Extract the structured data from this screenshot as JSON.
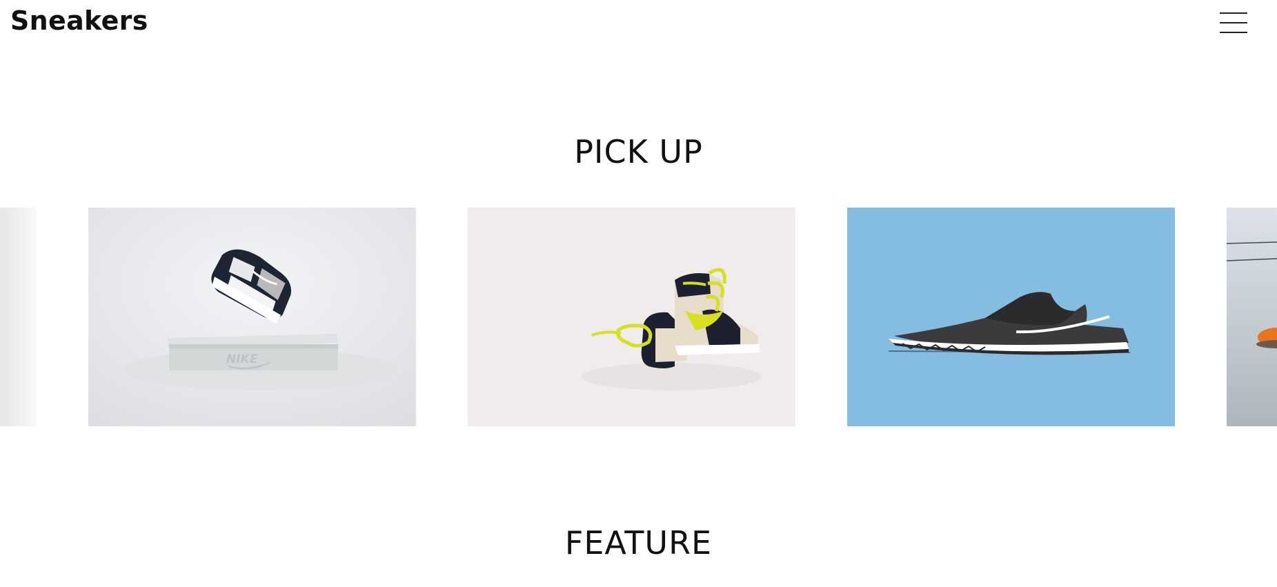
{
  "header": {
    "logo_text": "Sneakers",
    "menu_icon": "hamburger-menu-icon"
  },
  "pickup": {
    "title": "PICK UP",
    "slides": [
      {
        "icon": "sneaker-photo",
        "background": "#f1f2f1"
      },
      {
        "icon": "sneaker-on-box-photo",
        "background": "#e9eaec",
        "box_text": "NIKE"
      },
      {
        "icon": "yellow-lace-sneakers-photo",
        "background": "#efeceb"
      },
      {
        "icon": "black-sneaker-photo",
        "background": "#84bde0"
      },
      {
        "icon": "sneaker-photo",
        "background": "#c9d0d6"
      }
    ]
  },
  "feature": {
    "title": "FEATURE"
  },
  "colors": {
    "text": "#111111",
    "background": "#ffffff",
    "accent_blue": "#84bde0",
    "accent_yellow": "#d7e020"
  }
}
